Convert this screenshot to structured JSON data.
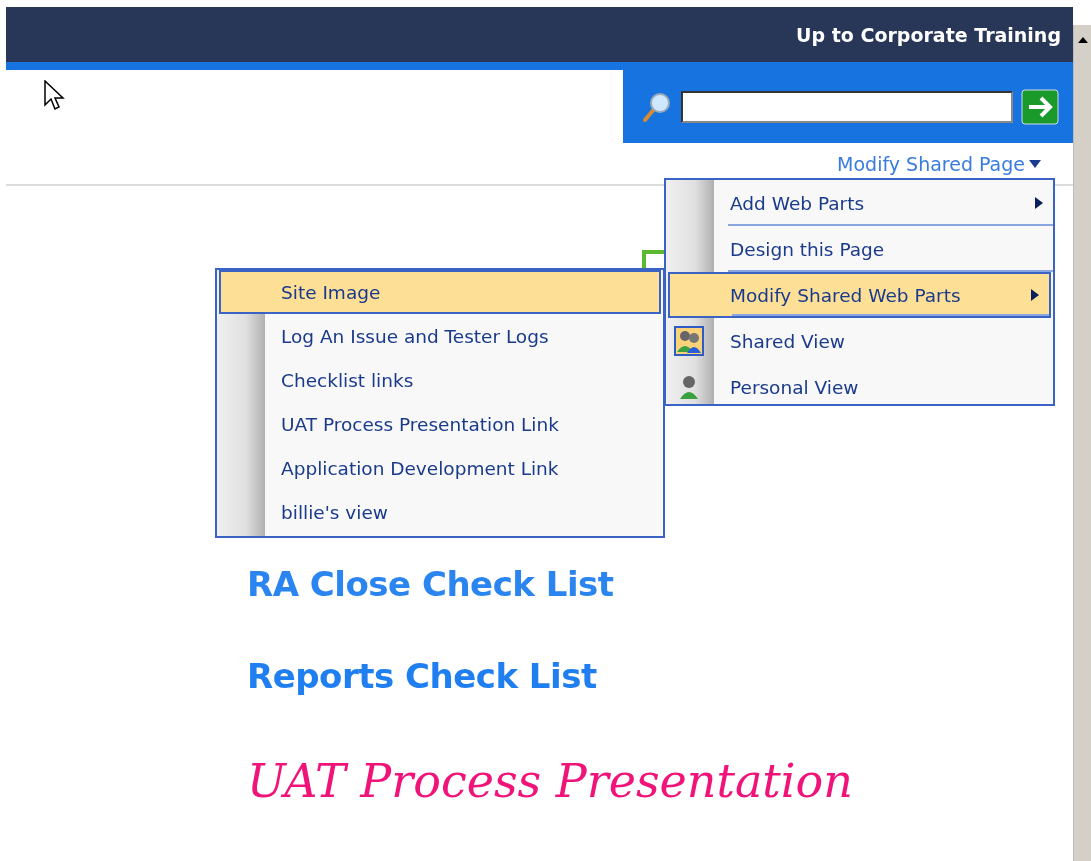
{
  "header": {
    "link": "Up to Corporate Training"
  },
  "site_actions": {
    "label": "Modify Shared Page"
  },
  "menu": {
    "items": [
      {
        "label": "Add Web Parts",
        "kind": "submenu",
        "selected": false
      },
      {
        "label": "Design this Page",
        "kind": "plain",
        "selected": false
      },
      {
        "label": "Modify Shared Web Parts",
        "kind": "submenu",
        "selected": true
      },
      {
        "label": "Shared View",
        "kind": "shared",
        "selected": false
      },
      {
        "label": "Personal View",
        "kind": "personal",
        "selected": false
      }
    ]
  },
  "submenu": {
    "items": [
      {
        "label": "Site Image",
        "selected": true
      },
      {
        "label": "Log An Issue and Tester Logs",
        "selected": false
      },
      {
        "label": "Checklist links",
        "selected": false
      },
      {
        "label": "UAT Process Presentation Link",
        "selected": false
      },
      {
        "label": "Application Development Link",
        "selected": false
      },
      {
        "label": "billie's view",
        "selected": false
      }
    ]
  },
  "headings": [
    {
      "text": "RA Close Check List",
      "kind": "blocky",
      "color": "#2a85f0"
    },
    {
      "text": "Reports Check List",
      "kind": "blocky",
      "color": "#1f7ff0"
    },
    {
      "text": "UAT Process Presentation",
      "kind": "handwritten",
      "color": "#f0147a"
    }
  ]
}
